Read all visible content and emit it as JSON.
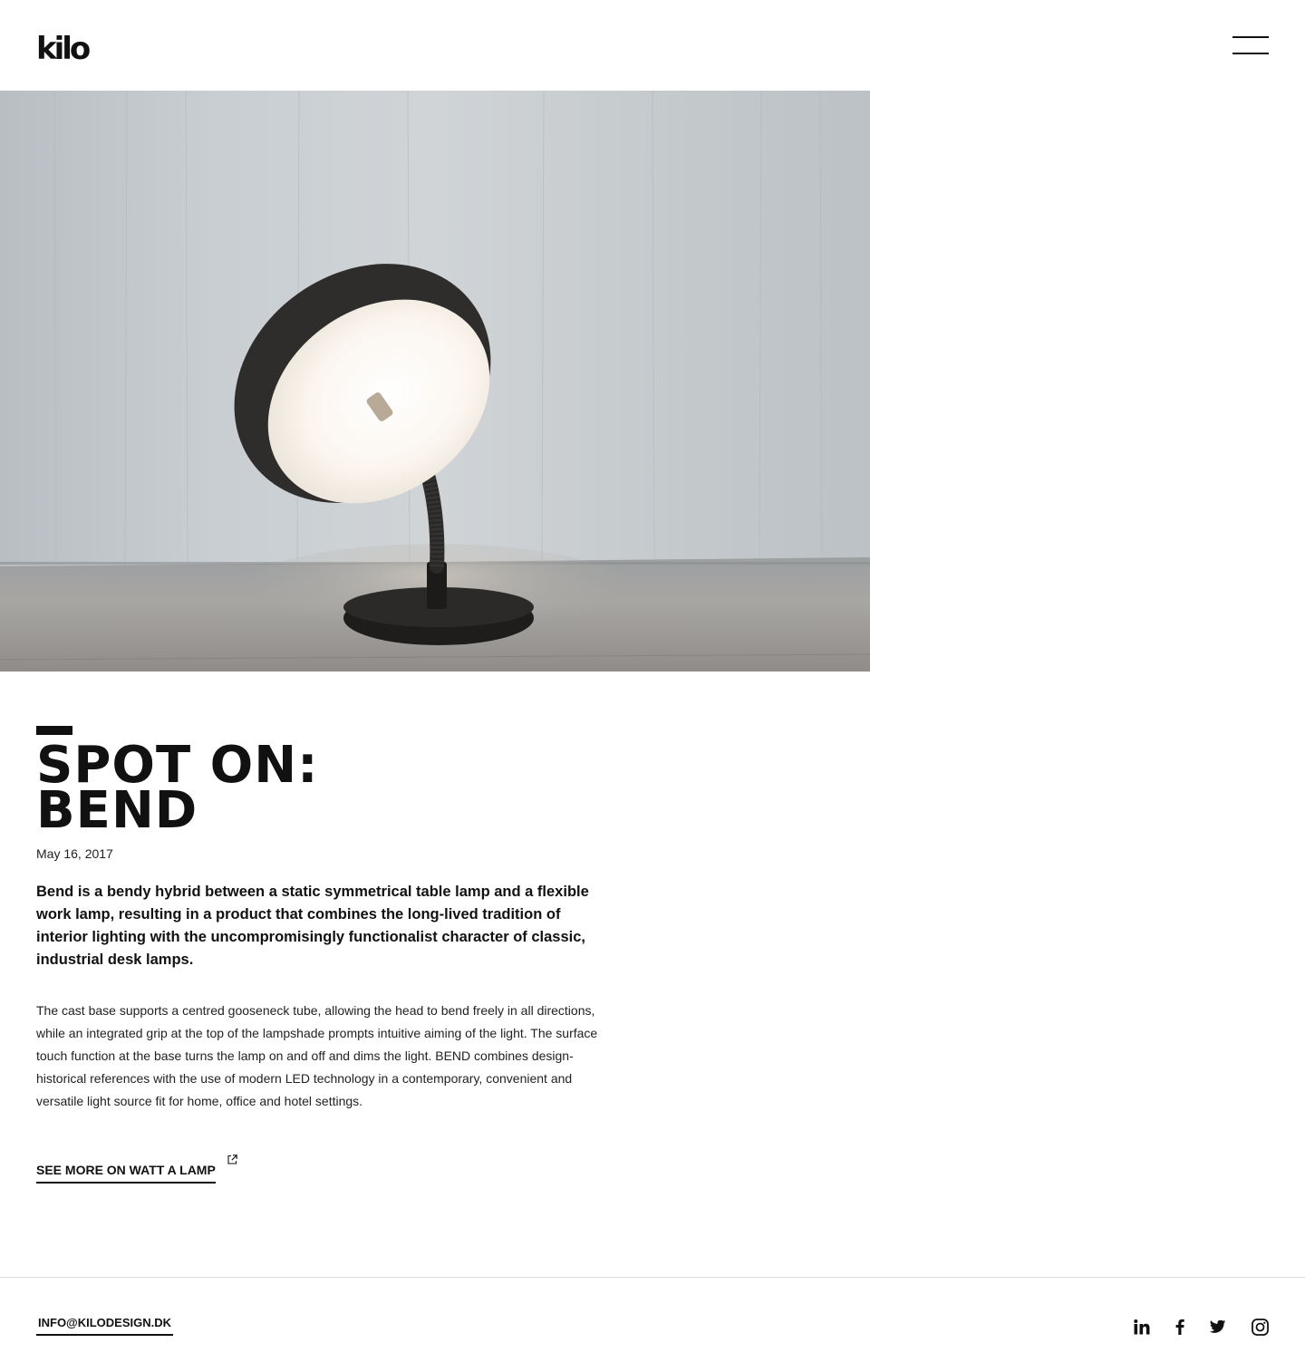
{
  "brand": {
    "logo_text": "kilo"
  },
  "header": {
    "menu_icon": "hamburger-menu-icon"
  },
  "hero": {
    "image_alt": "Bend table lamp on a wooden table"
  },
  "article": {
    "title_line1": "SPOT ON:",
    "title_line2": "BEND",
    "date": "May 16, 2017",
    "lead": "Bend is a bendy hybrid between a static symmetrical table lamp and a flexible work lamp, resulting in a product that combines the long-lived tradition of interior lighting with the uncompromisingly functionalist character of classic, industrial desk lamps.",
    "body": "The cast base supports a centred gooseneck tube, allowing the head to bend freely in all directions, while an integrated grip at the top of the lampshade prompts intuitive aiming of the light. The surface touch function at the base turns the lamp on and off and dims the light. BEND combines design-historical references with the use of modern LED technology in a contemporary, convenient and versatile light source fit for home, office and hotel settings.",
    "link_label": "SEE MORE ON WATT A LAMP",
    "link_icon": "external-link-icon"
  },
  "footer": {
    "email": "INFO@KILODESIGN.DK",
    "social": [
      "linkedin-icon",
      "facebook-icon",
      "twitter-icon",
      "instagram-icon"
    ]
  },
  "colors": {
    "text": "#111111",
    "background": "#ffffff",
    "divider": "#d9d9d9"
  }
}
